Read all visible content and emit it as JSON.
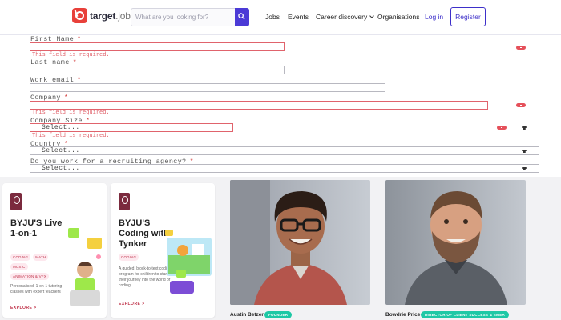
{
  "brand": {
    "name_bold": "target",
    "name_light": "jobs"
  },
  "search": {
    "placeholder": "What are you looking for?"
  },
  "nav": {
    "jobs": "Jobs",
    "events": "Events",
    "career": "Career discovery",
    "orgs": "Organisations",
    "login": "Log in",
    "register": "Register"
  },
  "form": {
    "first_name": {
      "label": "First Name",
      "req": "*",
      "error": "This field is required."
    },
    "last_name": {
      "label": "Last name",
      "req": "*"
    },
    "work_email": {
      "label": "Work email",
      "req": "*"
    },
    "company": {
      "label": "Company",
      "req": "*",
      "error": "This field is required."
    },
    "company_size": {
      "label": "Company Size",
      "req": "*",
      "value": "Select...",
      "error": "This field is required."
    },
    "country": {
      "label": "Country",
      "req": "*",
      "value": "Select..."
    },
    "agency": {
      "label": "Do you work for a recruiting agency?",
      "req": "*",
      "value": "Select..."
    }
  },
  "cards": [
    {
      "title": "BYJU'S Live 1-on-1",
      "tags": [
        "CODING",
        "MATH",
        "MUSIC",
        "ANIMATION & VFX"
      ],
      "desc": "Personalised, 1-on-1 tutoring classes with expert teachers",
      "cta": "EXPLORE >"
    },
    {
      "title": "BYJU'S Coding with Tynker",
      "tags": [
        "CODING"
      ],
      "desc": "A guided, block-to-text coding program for children to start their journey into the world of coding",
      "cta": "EXPLORE >"
    }
  ],
  "people": [
    {
      "name": "Austin Betzer",
      "role": "FOUNDER"
    },
    {
      "name": "Bowdrie Price",
      "role": "DIRECTOR OF CLIENT SUCCESS & EMEA"
    }
  ],
  "colors": {
    "accent": "#3d2fc9",
    "error": "#e0636c",
    "brand_red": "#e8403a",
    "badge": "#1ec8a5"
  }
}
